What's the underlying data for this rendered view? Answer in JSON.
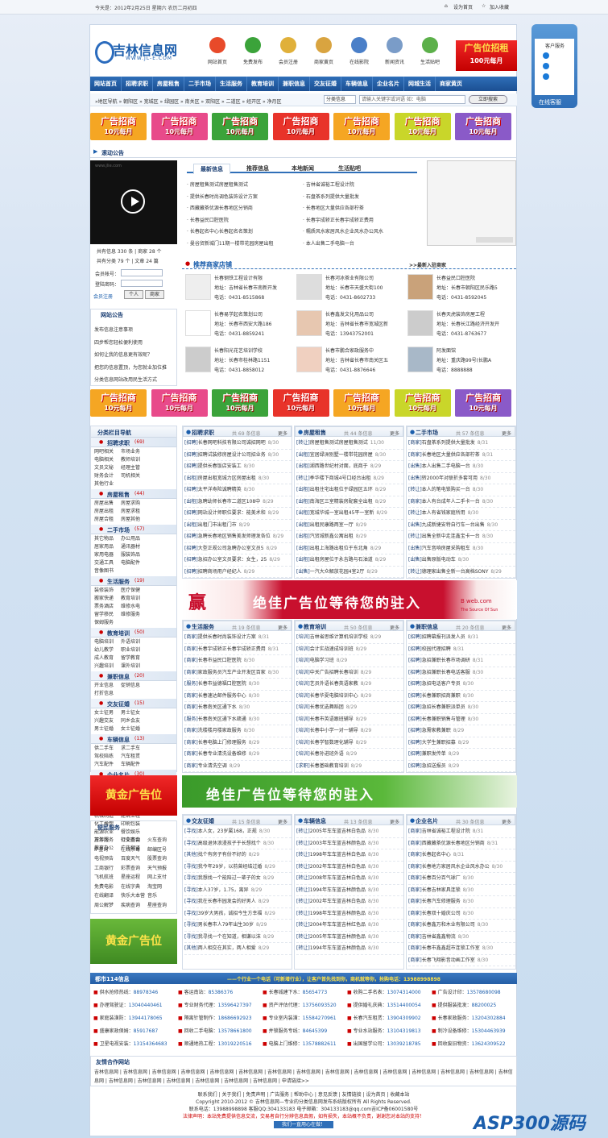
{
  "top": {
    "date": "今天是：2012年2月25日 星期六 农历二月初四",
    "set_home": "设为首页",
    "add_fav": "加入收藏"
  },
  "logo": {
    "cn": "吉林信息网",
    "en": "WWW.JL-E.COM"
  },
  "nav_icons": [
    "网站首页",
    "免费发布",
    "会员注册",
    "商家黄页",
    "在线影院",
    "新闻资讯",
    "生活贴吧"
  ],
  "ad_top": {
    "l1": "广告位招租",
    "l2": "100元每月"
  },
  "service": {
    "title": "客户服务",
    "online": "在线客服"
  },
  "mainnav": [
    "网站首页",
    "招聘求职",
    "房屋租售",
    "二手市场",
    "生活服务",
    "教育培训",
    "兼职信息",
    "交友征婚",
    "车辆信息",
    "企业名片",
    "网城生活",
    "商家黄页"
  ],
  "subnav": {
    "path": "»地区导航 » 朝阳区 » 宽城区 » 绿园区 » 南关区 » 双阳区 » 二道区 » 经开区 » 净月区",
    "select": "分类信息",
    "search_ph": "请输入关键字或词语 如：电脑",
    "search_btn": "立即搜索"
  },
  "banner": {
    "l1": "广告招商",
    "l2": "10元每月"
  },
  "notice": {
    "title": "滚动公告",
    "video_url": "www.jlie.com",
    "stats1": "共有信息 330 条 | 商家 28 个",
    "stats2": "共有分类 79 个 | 文章 24 篇"
  },
  "login": {
    "account": "会员帐号：",
    "password": "登陆密码：",
    "register": "会员注册",
    "personal": "个人",
    "merchant": "商家"
  },
  "site_notice": {
    "title": "网站公告",
    "items": [
      "发布信息注意事项",
      "四步帮您轻松便利使用",
      "如何让我的信息更有效呢？",
      "把您的信息置顶，为您就业加位推",
      "分类信息网站改用民生活方式"
    ]
  },
  "news_tabs": [
    "最新信息",
    "推荐信息",
    "本地新闻",
    "生活贴吧"
  ],
  "news_left": [
    "房屋租售测试房屋租售测试",
    "提供长春时尚调色装饰设计方案",
    "西藏藏茶优源长春地区分销商",
    "长春益民口腔医院",
    "长春起名中心长春起名名策划",
    "曼谷贸新城门11期一楼带花园房屋出租"
  ],
  "news_right": [
    "吉林省诚裕工程设计院",
    "石盘茶系列提供大量批发",
    "长春地区大量供应各部柠茶",
    "长春宇成轿正长春宇成轿正费用",
    "糯质风水家居风水企业风水办公风水",
    "本人出售二手电脑一台"
  ],
  "shops_title": "推荐商家店铺",
  "shops_more": ">>最新入驻商家",
  "shops": [
    {
      "n": "长春钢铁工程设计有限",
      "a": "地址：吉林省长春市南新开发",
      "t": "电话：0431-8515868"
    },
    {
      "n": "长春河冰茶业有限公司",
      "a": "地址：长春市天盛大街100",
      "t": "电话：0431-8602733"
    },
    {
      "n": "长春益民口腔医院",
      "a": "地址：长春市朝阳区民乐路5",
      "t": "电话：0431-8592045"
    },
    {
      "n": "长春易学起名策划公司",
      "a": "地址：长春市西安大路186",
      "t": "电话：0431-8859241"
    },
    {
      "n": "长春鑫发文化用品公司",
      "a": "地址：吉林省长春市宽城区新",
      "t": "电话：13943752001"
    },
    {
      "n": "长春天虎装饰房屋工程",
      "a": "地址：长春长江路经济开发开",
      "t": "电话：0431-8763677"
    },
    {
      "n": "长春阳光花艺培训学校",
      "a": "地址：长春市桂林路1151",
      "t": "电话：0431-8858012"
    },
    {
      "n": "长春市鹏合家政服务中",
      "a": "地址：吉林省长春市南关区五",
      "t": "电话：0431-8876646"
    },
    {
      "n": "阿发面馆",
      "a": "地址：重庆路99号(长鹏A",
      "t": "电话：8888888"
    }
  ],
  "catnav": {
    "title": "分类栏目导航",
    "cats": [
      {
        "name": "招聘求职",
        "n": "(69)",
        "subs": [
          "网吧相关",
          "市场业务",
          "电脑相关",
          "教师培训",
          "文员文秘",
          "经理主管",
          "财务会计",
          "司机相关",
          "其他行业"
        ]
      },
      {
        "name": "房屋租售",
        "n": "(44)",
        "subs": [
          "房屋出售",
          "房屋求购",
          "房屋出租",
          "房屋求租",
          "房屋合租",
          "房屋其他"
        ]
      },
      {
        "name": "二手市场",
        "n": "(57)",
        "subs": [
          "其它物品",
          "办公用品",
          "居家用品",
          "通讯器材",
          "家用电器",
          "服装饰品",
          "交通工具",
          "电脑配件",
          "音像图书"
        ]
      },
      {
        "name": "生活服务",
        "n": "(19)",
        "subs": [
          "装修装饰",
          "医疗保健",
          "搬家快递",
          "教育培训",
          "票务酒店",
          "维修水电",
          "留学移民",
          "维修服务",
          "保姆服务"
        ]
      },
      {
        "name": "教育培训",
        "n": "(50)",
        "subs": [
          "电脑培训",
          "外语培训",
          "幼儿教学",
          "职业培训",
          "成人教育",
          "留学教育",
          "兴趣培训",
          "课外培训"
        ]
      },
      {
        "name": "兼职信息",
        "n": "(20)",
        "subs": [
          "开业信息",
          "促销信息",
          "打折信息"
        ]
      },
      {
        "name": "交友征婚",
        "n": "(15)",
        "subs": [
          "女士征男",
          "男士征女",
          "兴趣交友",
          "同乡会友",
          "男士征婚",
          "女士征婚"
        ]
      },
      {
        "name": "车辆信息",
        "n": "(13)",
        "subs": [
          "供二手车",
          "求二手车",
          "驾校陪练",
          "汽车租赁",
          "汽车配件",
          "车辆配件"
        ]
      },
      {
        "name": "企业名片",
        "n": "(30)",
        "subs": [
          "汽车汽配",
          "机械电子",
          "家用电器",
          "服装服饰",
          "纺织皮革",
          "礼品玩具",
          "美容休闲",
          "医药食品",
          "机械制造",
          "建筑工程",
          "化工橡塑",
          "印刷包装",
          "能源农业",
          "餐饮娱乐",
          "旅游服务",
          "行业商会",
          "教育办公",
          "广告翻译"
        ]
      }
    ]
  },
  "gold_ad": "黄金广告位",
  "bigad1": {
    "t": "绝佳广告位等待您的驻入",
    "b": "B    web.com",
    "c": "The Source Of Sun"
  },
  "bigad2": "绝佳广告位等待您的驻入",
  "sections": [
    {
      "title": "招聘求职",
      "count": "共 69 条信息",
      "more": "更多",
      "rows": [
        [
          "[招聘]",
          "长春网吧科技有限公司诚招网吧",
          "8/30"
        ],
        [
          "[招聘]",
          "招聘试装修房屋设计公司招业务",
          "8/30"
        ],
        [
          "[招聘]",
          "提供长春饭店安装工",
          "8/30"
        ],
        [
          "[出租]",
          "房屋出租宽城力区房屋出租",
          "8/30"
        ],
        [
          "[招聘]",
          "太平洋寿险诚聘精英",
          "8/30"
        ],
        [
          "[出租]",
          "急聘幼师长春市二道区108中",
          "8/29"
        ],
        [
          "[招聘]",
          "网站设计师职位要求：能美术和",
          "8/29"
        ],
        [
          "[出租]",
          "出租门市出租门市",
          "8/29"
        ],
        [
          "[招聘]",
          "急聘长春地区销售美发师理发各位",
          "8/29"
        ],
        [
          "[招聘]",
          "大型正规公司急聘办公室文员5",
          "8/29"
        ],
        [
          "[招聘]",
          "急招办公室文员要求：女生，25",
          "8/29"
        ],
        [
          "[招聘]",
          "招聘商场用户经纪人",
          "8/29"
        ],
        [
          "[招聘]",
          "招聘前厅经理等职务",
          "8/29"
        ]
      ]
    },
    {
      "title": "房屋租售",
      "count": "共 44 条信息",
      "more": "更多",
      "rows": [
        [
          "[转让]",
          "房屋租售测试房屋租售测试",
          "11/30"
        ],
        [
          "[出租]",
          "宜居绿洲别墅一楼带花园房屋",
          "8/30"
        ],
        [
          "[出租]",
          "湖西路世纪村对面，底商于",
          "8/29"
        ],
        [
          "[转让]",
          "季华楼下商城4号口经台出租",
          "8/29"
        ],
        [
          "[出租]",
          "出租住宅出租位于绿园区五环",
          "8/29"
        ],
        [
          "[出租]",
          "南海区三室精装房配套全出租",
          "8/29"
        ],
        [
          "[出租]",
          "宽城华城一室出租45平一室新",
          "8/29"
        ],
        [
          "[出租]",
          "出租民康路两室一厅",
          "8/29"
        ],
        [
          "[出租]",
          "汽贸城新鑫公寓出租",
          "8/29"
        ],
        [
          "[出租]",
          "出租上海路出租位于东北角",
          "8/29"
        ],
        [
          "[出租]",
          "出租房屋位于永吉路与石油道",
          "8/29"
        ],
        [
          "[出售]",
          "一汽大众解放花园4室2厅",
          "8/29"
        ]
      ]
    },
    {
      "title": "二手市场",
      "count": "共 57 条信息",
      "more": "更多",
      "rows": [
        [
          "[商家]",
          "石盘茶系列提供大量批发",
          "8/31"
        ],
        [
          "[商家]",
          "长春地区大量供应各部柠茶",
          "8/31"
        ],
        [
          "[出售]",
          "本人出售二手电脑一台",
          "8/30"
        ],
        [
          "[出售]",
          "转2000年对联折多套可用",
          "8/30"
        ],
        [
          "[转让]",
          "本人的笔电锁购买一台",
          "8/30"
        ],
        [
          "[商家]",
          "本人有台成年人二手卡一台",
          "8/30"
        ],
        [
          "[转让]",
          "本人有省钱家庭所用",
          "8/30"
        ],
        [
          "[出售]",
          "九成新捷安特自行车一台出售",
          "8/30"
        ],
        [
          "[转让]",
          "出售全新中走连鑫宝卡一台",
          "8/30"
        ],
        [
          "[出售]",
          "汽车音响房屋采购租车",
          "8/30"
        ],
        [
          "[出售]",
          "出售原版电动车",
          "8/30"
        ],
        [
          "[转让]",
          "德理家出售全新一台高档SONY",
          "8/29"
        ],
        [
          "[转让]",
          "本人有一个儿童车出售",
          "8/29"
        ]
      ]
    },
    {
      "title": "生活服务",
      "count": "共 19 条信息",
      "more": "更多",
      "rows": [
        [
          "[商家]",
          "提供长春时尚装饰设计方案",
          "8/31"
        ],
        [
          "[商家]",
          "长春宇成轿正长春宇成轿正费用",
          "8/31"
        ],
        [
          "[商家]",
          "长春市益民口腔医院",
          "8/30"
        ],
        [
          "[商家]",
          "家政服务员汽车产业开发区百家",
          "8/30"
        ],
        [
          "[服务]",
          "长春市益德福口腔医院",
          "8/30"
        ],
        [
          "[商家]",
          "长春速达邮件服务中心",
          "8/30"
        ],
        [
          "[商家]",
          "长春南关区通下水",
          "8/30"
        ],
        [
          "[服务]",
          "长春南关区通下水疏通",
          "8/30"
        ],
        [
          "[商家]",
          "洗楼楼月楼家政服务",
          "8/30"
        ],
        [
          "[商家]",
          "长春电脑上门修理服务",
          "8/29"
        ],
        [
          "[商家]",
          "长春专业清洗设备维修",
          "8/29"
        ],
        [
          "[商家]",
          "专业清洗空调",
          "8/29"
        ]
      ]
    },
    {
      "title": "教育培训",
      "count": "共 50 条信息",
      "more": "更多",
      "rows": [
        [
          "[培训]",
          "吉林省思维计算机培训学校",
          "8/29"
        ],
        [
          "[培训]",
          "会计实战速成培训班",
          "8/29"
        ],
        [
          "[培训]",
          "电脑学习班",
          "8/29"
        ],
        [
          "[培训]",
          "中关广告招聘长春培训",
          "8/29"
        ],
        [
          "[培训]",
          "艺员外语长春英语家教",
          "8/29"
        ],
        [
          "[培训]",
          "长春华夏电脑培训中心",
          "8/29"
        ],
        [
          "[培训]",
          "长春优选舞蹈团",
          "8/29"
        ],
        [
          "[培训]",
          "长春市英语跟班辅导",
          "8/29"
        ],
        [
          "[培训]",
          "长春中小学一对一辅导",
          "8/29"
        ],
        [
          "[培训]",
          "长春学智数理化辅导",
          "8/29"
        ],
        [
          "[培训]",
          "长春孙进班外语",
          "8/29"
        ],
        [
          "[求职]",
          "长春基础教育培训",
          "8/29"
        ]
      ]
    },
    {
      "title": "兼职信息",
      "count": "共 20 条信息",
      "more": "更多",
      "rows": [
        [
          "[招聘]",
          "招聘幕报刊派发人员",
          "8/31"
        ],
        [
          "[招聘]",
          "校园代理招聘",
          "8/31"
        ],
        [
          "[招聘]",
          "急招兼职长春市场调研",
          "8/31"
        ],
        [
          "[招聘]",
          "急招兼职长春电话客服",
          "8/30"
        ],
        [
          "[招聘]",
          "急招电话客户专员",
          "8/30"
        ],
        [
          "[招聘]",
          "长春兼职招商兼职",
          "8/30"
        ],
        [
          "[招聘]",
          "急招长春兼职派单员",
          "8/30"
        ],
        [
          "[招聘]",
          "长春兼职销售与管理",
          "8/30"
        ],
        [
          "[招聘]",
          "急需家教兼职",
          "8/29"
        ],
        [
          "[招聘]",
          "大学生兼职招募",
          "8/29"
        ],
        [
          "[招聘]",
          "兼职发传单",
          "8/29"
        ],
        [
          "[招聘]",
          "急招送报员",
          "8/29"
        ]
      ]
    },
    {
      "title": "交友征婚",
      "count": "共 15 条信息",
      "more": "更多",
      "rows": [
        [
          "[寻找]",
          "本人女，23岁属168，正规",
          "8/30"
        ],
        [
          "[寻找]",
          "高级退休浪漫孩子于长想找个",
          "8/30"
        ],
        [
          "[其他]",
          "找个有房子有份不好的",
          "8/29"
        ],
        [
          "[寻找]",
          "我今年29岁，以前曾经结过婚",
          "8/29"
        ],
        [
          "[寻找]",
          "我想找一个能陪过一辈子的女",
          "8/29"
        ],
        [
          "[寻找]",
          "本人37岁，1.75，离异",
          "8/29"
        ],
        [
          "[寻找]",
          "我在长春市园发会的好男人",
          "8/29"
        ],
        [
          "[寻找]",
          "39岁大男孩，诚招今生方幸福",
          "8/29"
        ],
        [
          "[寻找]",
          "男长春市人79年出生30岁",
          "8/29"
        ],
        [
          "[寻找]",
          "我寻找一个在知道，相谦以沫",
          "8/29"
        ],
        [
          "[其他]",
          "两人相交在其实，两人相爱",
          "8/29"
        ]
      ]
    },
    {
      "title": "车辆信息",
      "count": "共 13 条信息",
      "more": "更多",
      "rows": [
        [
          "[转让]",
          "2005年车车蓝吉林白色品",
          "8/30"
        ],
        [
          "[转让]",
          "2003年车车蓝吉林颜色品",
          "8/30"
        ],
        [
          "[转让]",
          "1998年车车蓝吉林白色品",
          "8/30"
        ],
        [
          "[转让]",
          "2002年车车蓝吉林白色品",
          "8/30"
        ],
        [
          "[转让]",
          "2008年车车蓝吉林白色品",
          "8/30"
        ],
        [
          "[转让]",
          "1994年车车蓝吉林颜色品",
          "8/30"
        ],
        [
          "[转让]",
          "2002年车车蓝吉林白色品",
          "8/30"
        ],
        [
          "[转让]",
          "1998年车车蓝吉林颜色品",
          "8/30"
        ],
        [
          "[转让]",
          "2004年车车蓝吉林红色品",
          "8/30"
        ],
        [
          "[转让]",
          "2005年车车蓝吉林颜色品",
          "8/30"
        ],
        [
          "[转让]",
          "1994年车车蓝吉林颜色品",
          "8/30"
        ]
      ]
    },
    {
      "title": "企业名片",
      "count": "共 30 条信息",
      "more": "更多",
      "rows": [
        [
          "[商家]",
          "吉林省诚裕工程设计院",
          "8/31"
        ],
        [
          "[商家]",
          "西藏藏茶优源长春地区分销商",
          "8/31"
        ],
        [
          "[商家]",
          "长春起名中心",
          "8/31"
        ],
        [
          "[商家]",
          "长春地方家居风水企业风水办公",
          "8/30"
        ],
        [
          "[商家]",
          "长春百分百气球厂",
          "8/30"
        ],
        [
          "[商家]",
          "长春吉林家具连锁",
          "8/30"
        ],
        [
          "[商家]",
          "长春汽车修理服务",
          "8/30"
        ],
        [
          "[商家]",
          "长春双十婚庆公司",
          "8/30"
        ],
        [
          "[商家]",
          "长春鑫万和木业有限公司",
          "8/30"
        ],
        [
          "[商家]",
          "吉林省鑫鑫物流",
          "8/30"
        ],
        [
          "[商家]",
          "长春市鑫鑫超市连锁工作室",
          "8/30"
        ],
        [
          "[商家]",
          "长春飞翔影音动画工作室",
          "8/30"
        ]
      ]
    }
  ],
  "convenience": {
    "title": "便民服务",
    "items": [
      "万年历",
      "公交查询",
      "火车查询",
      "IP查询",
      "在线杀毒",
      "邮编区号",
      "电视预告",
      "百度天气",
      "股票查询",
      "工商银行",
      "彩票查询",
      "天气预报",
      "飞机航班",
      "星座运程",
      "网上支付",
      "免费电影",
      "在线字典",
      "淘宝网",
      "在线翻译",
      "快乐大本营",
      "音乐",
      "周公解梦",
      "疾病查询",
      "星座查询"
    ]
  },
  "infobar": {
    "title": "都市114信息",
    "text": "——个行业一个电话（可新增行业），让客户首先找到你，商机就等你，抢购电话：13988998898"
  },
  "contacts": [
    [
      "供水抢修热线：",
      "88978346"
    ],
    [
      "客运南站：",
      "85386376"
    ],
    [
      "长春城建下水：",
      "85654773"
    ],
    [
      "收购二手名表：",
      "13074314000"
    ],
    [
      "广告设计印：",
      "13578680098"
    ],
    [
      "办理驾驶证：",
      "13040440461"
    ],
    [
      "专业财务代理：",
      "13596427397"
    ],
    [
      "资产评估代理：",
      "13756093520"
    ],
    [
      "提供婚礼庆典：",
      "13514400054"
    ],
    [
      "提供服装批发：",
      "88200025"
    ],
    [
      "家庭装潢防：",
      "13944178065"
    ],
    [
      "隔离针管制作：",
      "18686692923"
    ],
    [
      "专业室内装潢：",
      "15584270961"
    ],
    [
      "长春汽车租赁：",
      "13904309902"
    ],
    [
      "长春家政服务：",
      "13204302884"
    ],
    [
      "盛康家政保姆：",
      "85917687"
    ],
    [
      "回收二手电脑：",
      "13578661800"
    ],
    [
      "并锁服务专线：",
      "84645399"
    ],
    [
      "专业水站服务：",
      "13104319813"
    ],
    [
      "制冷设备维修：",
      "15304463939"
    ],
    [
      "卫星电视安装：",
      "13154364683"
    ],
    [
      "顺通地热工程：",
      "13019220516"
    ],
    [
      "电脑上门维修：",
      "13578882611"
    ],
    [
      "出国留学公司：",
      "13039218785"
    ],
    [
      "回收废旧物资：",
      "13624309522"
    ]
  ],
  "links": {
    "title": "友情合作网站",
    "items": "吉林信息网 | 吉林信息网 | 吉林信息网 | 吉林信息网 | 吉林信息网 | 吉林信息网 | 吉林信息网 | 吉林信息网 | 吉林信息网 | 吉林信息网 | 吉林信息网 | 吉林信息网 | 吉林信息网 | 吉林信息网 | 吉林信息网 | 吉林信息网 | 吉林信息网 | 吉林信息网 | 吉林信息网 | 吉林信息网 | 吉林信息网 | 申请链接>>"
  },
  "footer": {
    "l1": "联系我们 | 关于我们 | 免责声明 | 广告服务 | 帮助中心 | 意见反馈 | 友情链接 | 设为首页 | 收藏本站",
    "l2": "Copyright 2010-2012 © 吉林信息网—专业的分类信息网发布系统版权所有 All Rights Reserved.",
    "l3": "联系电话：13988998898  客服QQ:304133183 电子邮箱：304133183@qq.com吉ICP备06001580号",
    "l4": "法律声明：本站免费提供信息交流，交易者自行分辨信息真假，如有损失，本站概不负责，谢谢您对本站的支持！",
    "l5": "我们一直用心在做！"
  },
  "watermark": "ASP300源码"
}
